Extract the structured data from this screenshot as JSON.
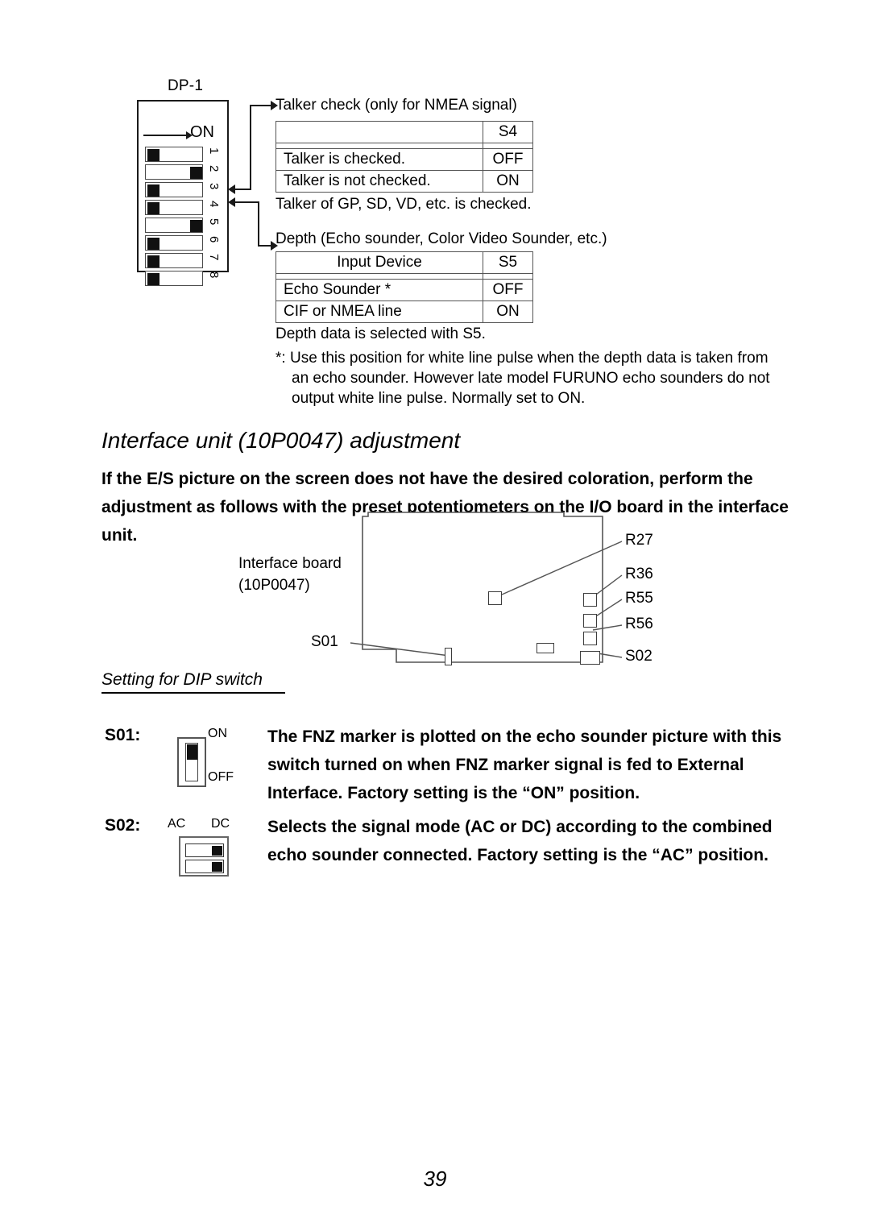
{
  "dip_figure": {
    "block_label": "DP-1",
    "on_label": "ON",
    "switches": [
      {
        "number": "1",
        "position": "left"
      },
      {
        "number": "2",
        "position": "right"
      },
      {
        "number": "3",
        "position": "left"
      },
      {
        "number": "4",
        "position": "left"
      },
      {
        "number": "5",
        "position": "right"
      },
      {
        "number": "6",
        "position": "left"
      },
      {
        "number": "7",
        "position": "left"
      },
      {
        "number": "8",
        "position": "left"
      }
    ]
  },
  "talker_table": {
    "caption": "Talker check (only for NMEA signal)",
    "header": {
      "label": "",
      "switch": "S4"
    },
    "rows": [
      {
        "label": "Talker is checked.",
        "value": "OFF"
      },
      {
        "label": "Talker is not checked.",
        "value": "ON"
      }
    ],
    "note": "Talker of GP, SD, VD, etc. is checked."
  },
  "depth_table": {
    "caption": "Depth (Echo sounder, Color Video Sounder, etc.)",
    "header": {
      "label": "Input Device",
      "switch": "S5"
    },
    "rows": [
      {
        "label": "Echo Sounder *",
        "value": "OFF"
      },
      {
        "label": "CIF or NMEA line",
        "value": "ON"
      }
    ],
    "note": "Depth data is selected with S5."
  },
  "footnote": {
    "marker": "*:",
    "text": "Use this position for white line pulse when the depth data is taken from an echo sounder. However late model FURUNO echo sounders do not output white line pulse. Normally set to ON."
  },
  "section": {
    "heading": "Interface unit (10P0047) adjustment",
    "intro": "If the E/S picture on the screen does not have the desired coloration, perform the adjustment as follows with the preset potentiometers on the I/O board in the interface unit."
  },
  "board": {
    "name_line1": "Interface board",
    "name_line2": "(10P0047)",
    "callouts": {
      "r27": "R27",
      "r36": "R36",
      "r55": "R55",
      "r56": "R56",
      "s02": "S02",
      "s01": "S01"
    }
  },
  "dip_setting": {
    "sub_heading": "Setting for DIP switch",
    "s01": {
      "key": "S01:",
      "on_label": "ON",
      "off_label": "OFF",
      "position": "ON",
      "description": "The FNZ marker is plotted on the echo sounder picture with this switch turned on when FNZ marker signal is fed to External Interface. Factory setting is the “ON” position."
    },
    "s02": {
      "key": "S02:",
      "left_label": "AC",
      "right_label": "DC",
      "description": "Selects the signal mode (AC or DC) according to the combined echo sounder connected. Factory setting is the “AC” position."
    }
  },
  "page": {
    "number": "39"
  }
}
